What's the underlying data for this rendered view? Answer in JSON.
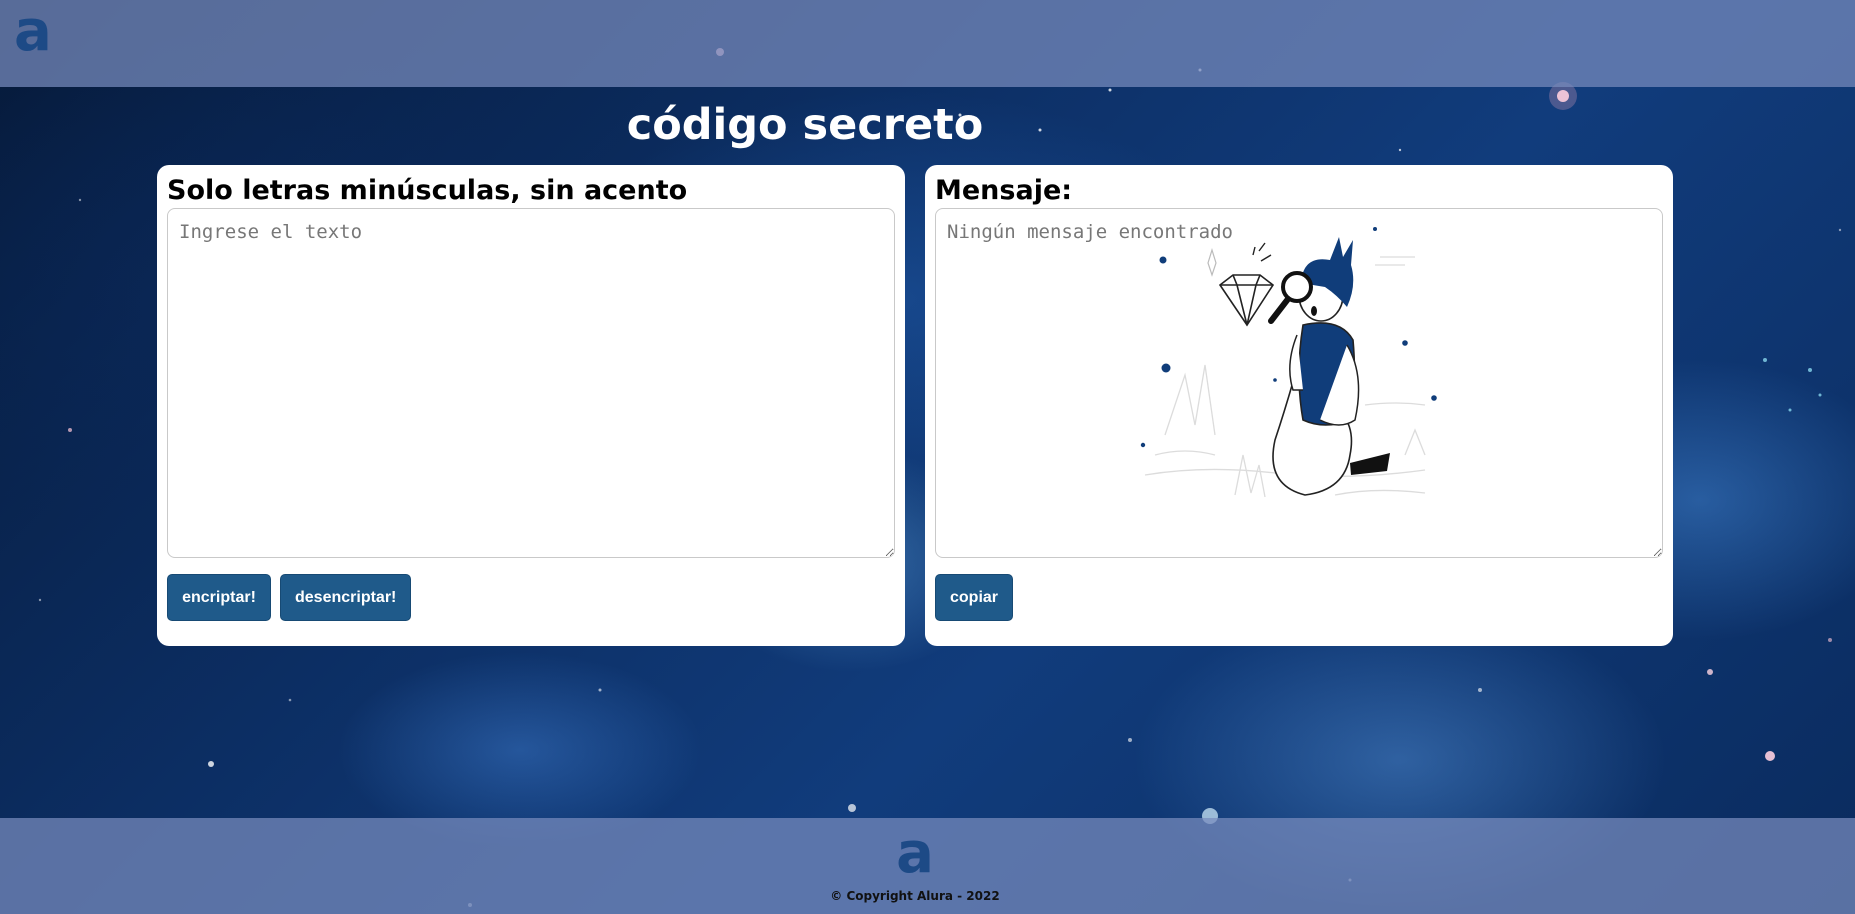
{
  "header": {
    "logo_letter": "a"
  },
  "page_title": "código secreto",
  "input_panel": {
    "heading": "Solo letras minúsculas, sin acento",
    "placeholder": "Ingrese el texto",
    "encrypt_label": "encriptar!",
    "decrypt_label": "desencriptar!"
  },
  "output_panel": {
    "heading": "Mensaje:",
    "placeholder": "Ningún mensaje encontrado",
    "copy_label": "copiar",
    "illustration_icon": "person-magnifying-glass-diamond"
  },
  "footer": {
    "logo_letter": "a",
    "copyright": "© Copyright Alura - 2022"
  },
  "colors": {
    "button": "#1f5a8a",
    "logo": "#1d4a86",
    "bars": "#788cbe",
    "card": "#ffffff"
  }
}
